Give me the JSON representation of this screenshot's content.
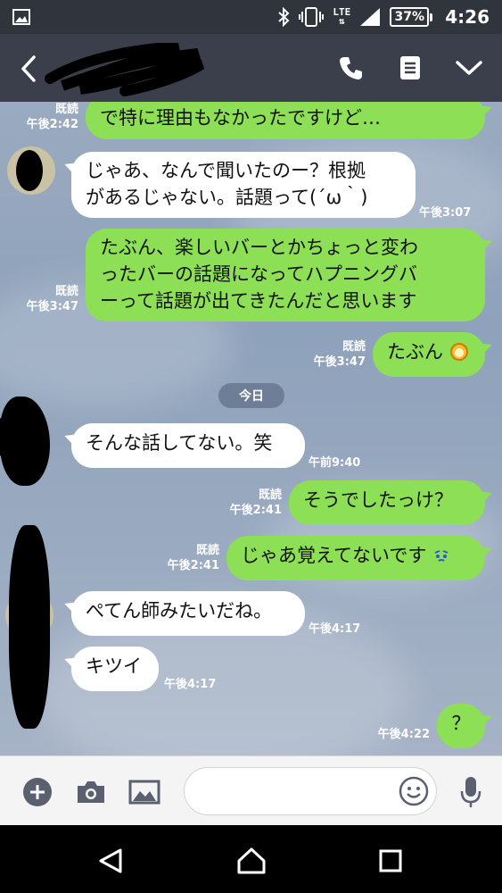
{
  "status_bar": {
    "network": "LTE",
    "battery": "37%",
    "time": "4:26",
    "icons": [
      "gallery-icon",
      "bluetooth-icon",
      "vibrate-icon",
      "signal-icon",
      "battery-icon"
    ]
  },
  "header": {
    "icons": [
      "back-icon",
      "phone-icon",
      "note-icon",
      "chevron-down-icon"
    ]
  },
  "day_separator": "今日",
  "messages": [
    {
      "side": "mine",
      "text": "で特に理由もなかったですけど…",
      "read": "既読",
      "time": "午後2:42"
    },
    {
      "side": "theirs",
      "lines": [
        "じゃあ、なんで聞いたのー？根拠",
        "があるじゃない。話題って(´ω｀)"
      ],
      "time": "午後3:07"
    },
    {
      "side": "mine",
      "lines": [
        "たぶん、楽しいバーとかちょっと変わ",
        "ったバーの話題になってハプニングバ",
        "ーって話題が出てきたんだと思います"
      ],
      "read": "既読",
      "time": "午後3:47"
    },
    {
      "side": "mine",
      "text": "たぶん",
      "read": "既読",
      "time": "午後3:47"
    },
    {
      "side": "theirs",
      "text": "そんな話してない。笑",
      "time": "午前9:40"
    },
    {
      "side": "mine",
      "text": "そうでしたっけ？",
      "read": "既読",
      "time": "午後2:41"
    },
    {
      "side": "mine",
      "text": "じゃあ覚えてないです",
      "read": "既読",
      "time": "午後2:41"
    },
    {
      "side": "theirs",
      "text": "ぺてん師みたいだね。",
      "time": "午後4:17"
    },
    {
      "side": "theirs",
      "text": "キツイ",
      "time": "午後4:17"
    },
    {
      "side": "mine",
      "text": "？",
      "time": "午後4:22"
    }
  ],
  "input_bar": {
    "placeholder": "",
    "icons": [
      "plus-icon",
      "camera-icon",
      "image-icon",
      "emoji-icon",
      "microphone-icon"
    ]
  },
  "nav_bar": {
    "icons": [
      "nav-back-icon",
      "nav-home-icon",
      "nav-recents-icon"
    ]
  }
}
